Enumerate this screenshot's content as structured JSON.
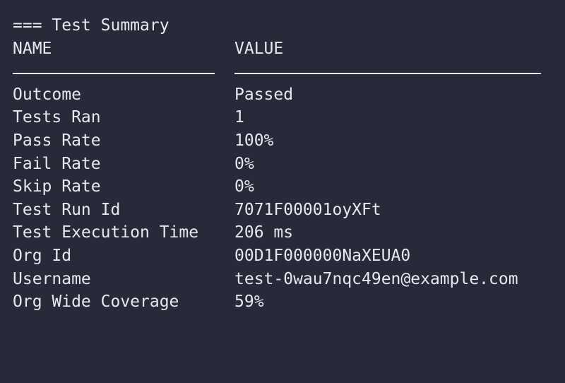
{
  "header": {
    "title": "=== Test Summary"
  },
  "columns": {
    "name": "NAME",
    "value": "VALUE"
  },
  "rows": [
    {
      "name": "Outcome",
      "value": "Passed"
    },
    {
      "name": "Tests Ran",
      "value": "1"
    },
    {
      "name": "Pass Rate",
      "value": "100%"
    },
    {
      "name": "Fail Rate",
      "value": "0%"
    },
    {
      "name": "Skip Rate",
      "value": "0%"
    },
    {
      "name": "Test Run Id",
      "value": "7071F00001oyXFt"
    },
    {
      "name": "Test Execution Time",
      "value": "206 ms"
    },
    {
      "name": "Org Id",
      "value": "00D1F000000NaXEUA0"
    },
    {
      "name": "Username",
      "value": "test-0wau7nqc49en@example.com"
    },
    {
      "name": "Org Wide Coverage",
      "value": "59%"
    }
  ],
  "colors": {
    "background": "#262a39",
    "foreground": "#e6e8ee"
  }
}
